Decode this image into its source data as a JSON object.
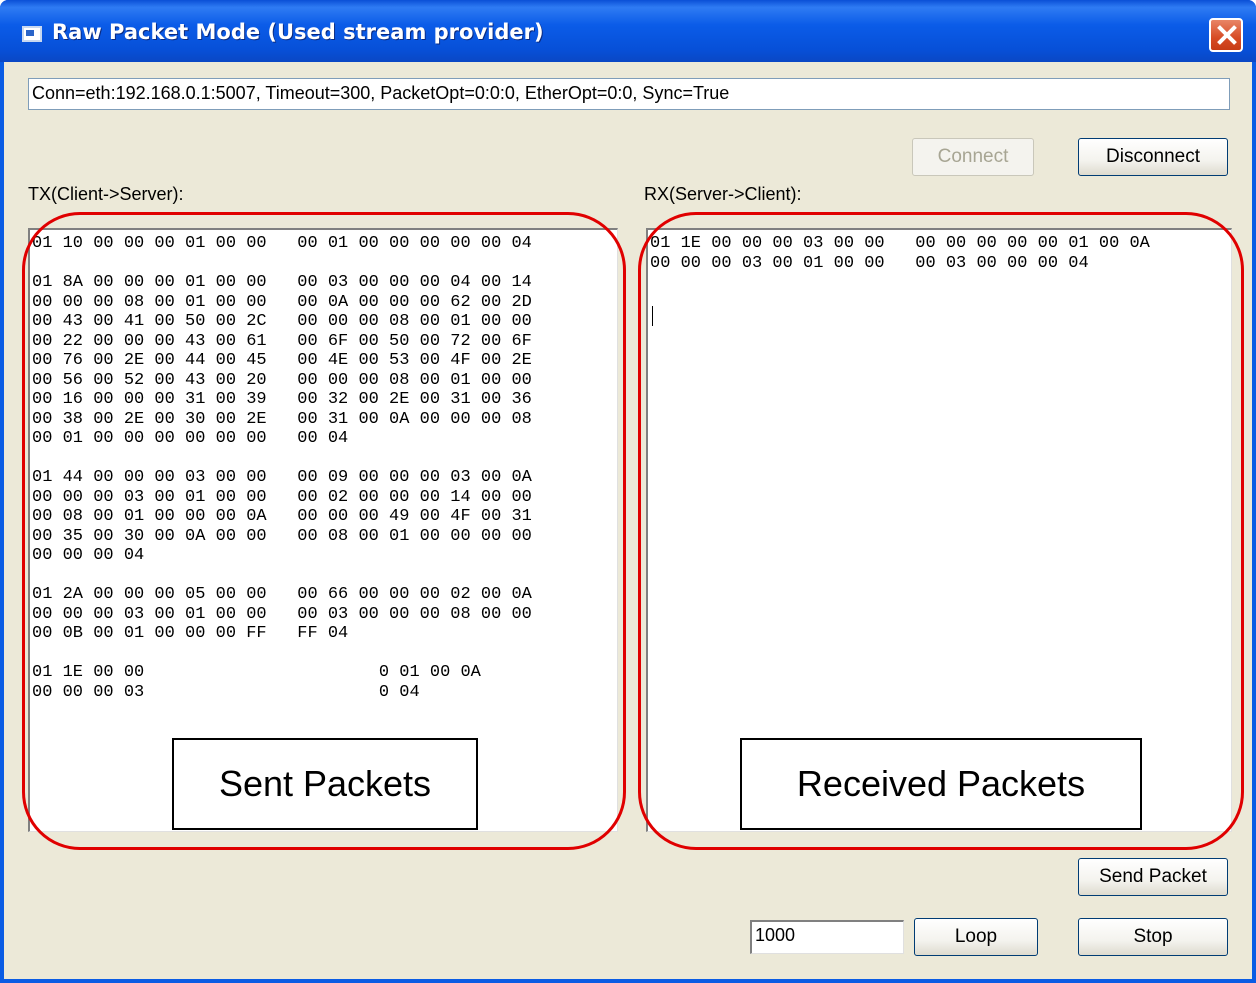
{
  "window": {
    "title": "Raw Packet Mode (Used stream provider)"
  },
  "connection": {
    "value": "Conn=eth:192.168.0.1:5007, Timeout=300, PacketOpt=0:0:0, EtherOpt=0:0, Sync=True"
  },
  "buttons": {
    "connect": "Connect",
    "disconnect": "Disconnect",
    "send_packet": "Send Packet",
    "loop": "Loop",
    "stop": "Stop"
  },
  "tx": {
    "label": "TX(Client->Server):",
    "text": "01 10 00 00 00 01 00 00   00 01 00 00 00 00 00 04\n\n01 8A 00 00 00 01 00 00   00 03 00 00 00 04 00 14\n00 00 00 08 00 01 00 00   00 0A 00 00 00 62 00 2D\n00 43 00 41 00 50 00 2C   00 00 00 08 00 01 00 00\n00 22 00 00 00 43 00 61   00 6F 00 50 00 72 00 6F\n00 76 00 2E 00 44 00 45   00 4E 00 53 00 4F 00 2E\n00 56 00 52 00 43 00 20   00 00 00 08 00 01 00 00\n00 16 00 00 00 31 00 39   00 32 00 2E 00 31 00 36\n00 38 00 2E 00 30 00 2E   00 31 00 0A 00 00 00 08\n00 01 00 00 00 00 00 00   00 04\n\n01 44 00 00 00 03 00 00   00 09 00 00 00 03 00 0A\n00 00 00 03 00 01 00 00   00 02 00 00 00 14 00 00\n00 08 00 01 00 00 00 0A   00 00 00 49 00 4F 00 31\n00 35 00 30 00 0A 00 00   00 08 00 01 00 00 00 00\n00 00 00 04\n\n01 2A 00 00 00 05 00 00   00 66 00 00 00 02 00 0A\n00 00 00 03 00 01 00 00   00 03 00 00 00 08 00 00\n00 0B 00 01 00 00 00 FF   FF 04\n\n01 1E 00 00                       0 01 00 0A\n00 00 00 03                       0 04"
  },
  "rx": {
    "label": "RX(Server->Client):",
    "text": "01 1E 00 00 00 03 00 00   00 00 00 00 00 01 00 0A\n00 00 00 03 00 01 00 00   00 03 00 00 00 04"
  },
  "loop_count": "1000",
  "annotations": {
    "sent": "Sent Packets",
    "received": "Received Packets",
    "ring_color": "#e00000"
  }
}
